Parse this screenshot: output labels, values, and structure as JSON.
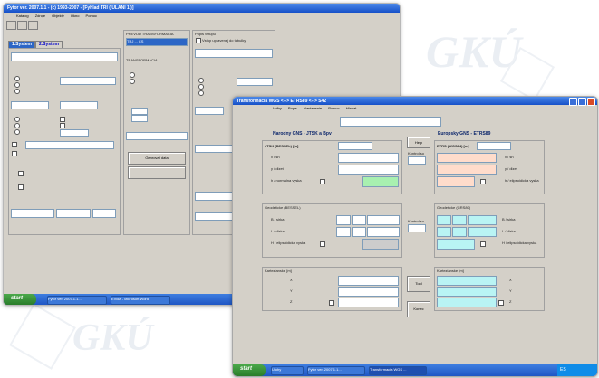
{
  "shot1": {
    "title": "Fytor ver. 2007.1.1 - (c) 1993-2007 - [Fyhlad TRI ( ULANI 1 )]",
    "menu": [
      "Katalog",
      "Zdroje",
      "Objekty",
      "Okno",
      "Pomoc"
    ],
    "tabs": [
      "1.System",
      "2.System"
    ],
    "mid_frame_title": "PREVOD TRANSFORMACIA",
    "mid_select": "TRJ ... CS",
    "transform_title": "TRANSFORMACIA",
    "transform_button": "Genrovat data",
    "right_frame_title": "Popis vstupu",
    "right_check_label": "Vstup upravenej do tabulky",
    "right_select": "",
    "left_select_a": "",
    "left_select_b": "",
    "ellipsoid_left": "",
    "ellipsoid_right": "",
    "right_labels": [],
    "taskbar_start": "start",
    "taskbar_tasks": [
      "Fytor ver. 2007.1.1...",
      "EVida - Microsoft Word"
    ]
  },
  "shot2": {
    "title": "Transformacia WGS <--> ETRS89 <--> S42",
    "menu": [
      "Volby",
      "Popis",
      "Nastavenie",
      "Pomoc",
      "Hladat"
    ],
    "left_header": "Narodny GNS - JTSK a Bpv",
    "right_header": "Europsky GNS - ETRS89",
    "jtsk_title": "JTSK (BESSEL) [m]",
    "etrs_title": "ETRS (WGS84) [m]",
    "left_select": "",
    "right_select": "",
    "left_row_labels": [
      "x / sh",
      "y / dlzet",
      "h / normalna vyska"
    ],
    "right_row_labels": [
      "x / sh",
      "y / dlzet",
      "h / elipsoidicka vyska"
    ],
    "btn_help": "Help",
    "kontrol1": "Kontrol so",
    "geo_left_title": "Geodeticke (BESSEL)",
    "geo_right_title": "Geodeticke (GRS80)",
    "geo_left_labels": [
      "B / sirka",
      "L / dlzka",
      "H / elipsoidicka vyska"
    ],
    "geo_right_labels": [
      "B / sirka",
      "L / dlzka",
      "H / elipsoidicka vyska"
    ],
    "kontrol2": "Kontrol so",
    "cart_left_title": "Kartezianske [m]",
    "cart_right_title": "Kartezianske [m]",
    "cart_labels": [
      "X",
      "Y",
      "Z"
    ],
    "btn_tool": "Tool",
    "btn_konec": "Konec",
    "footer": [],
    "taskbar_start": "start",
    "taskbar_tasks": [
      "Ulohy",
      "Fytor ver. 2007.1.1...",
      "Transformacia WGS ..."
    ],
    "tray_text": "ES"
  },
  "colors": {
    "title_blue": "#1d5cd3",
    "input_green": "#a8f0b0",
    "input_peach": "#ffdccb",
    "input_cyan": "#b9f4f4"
  }
}
